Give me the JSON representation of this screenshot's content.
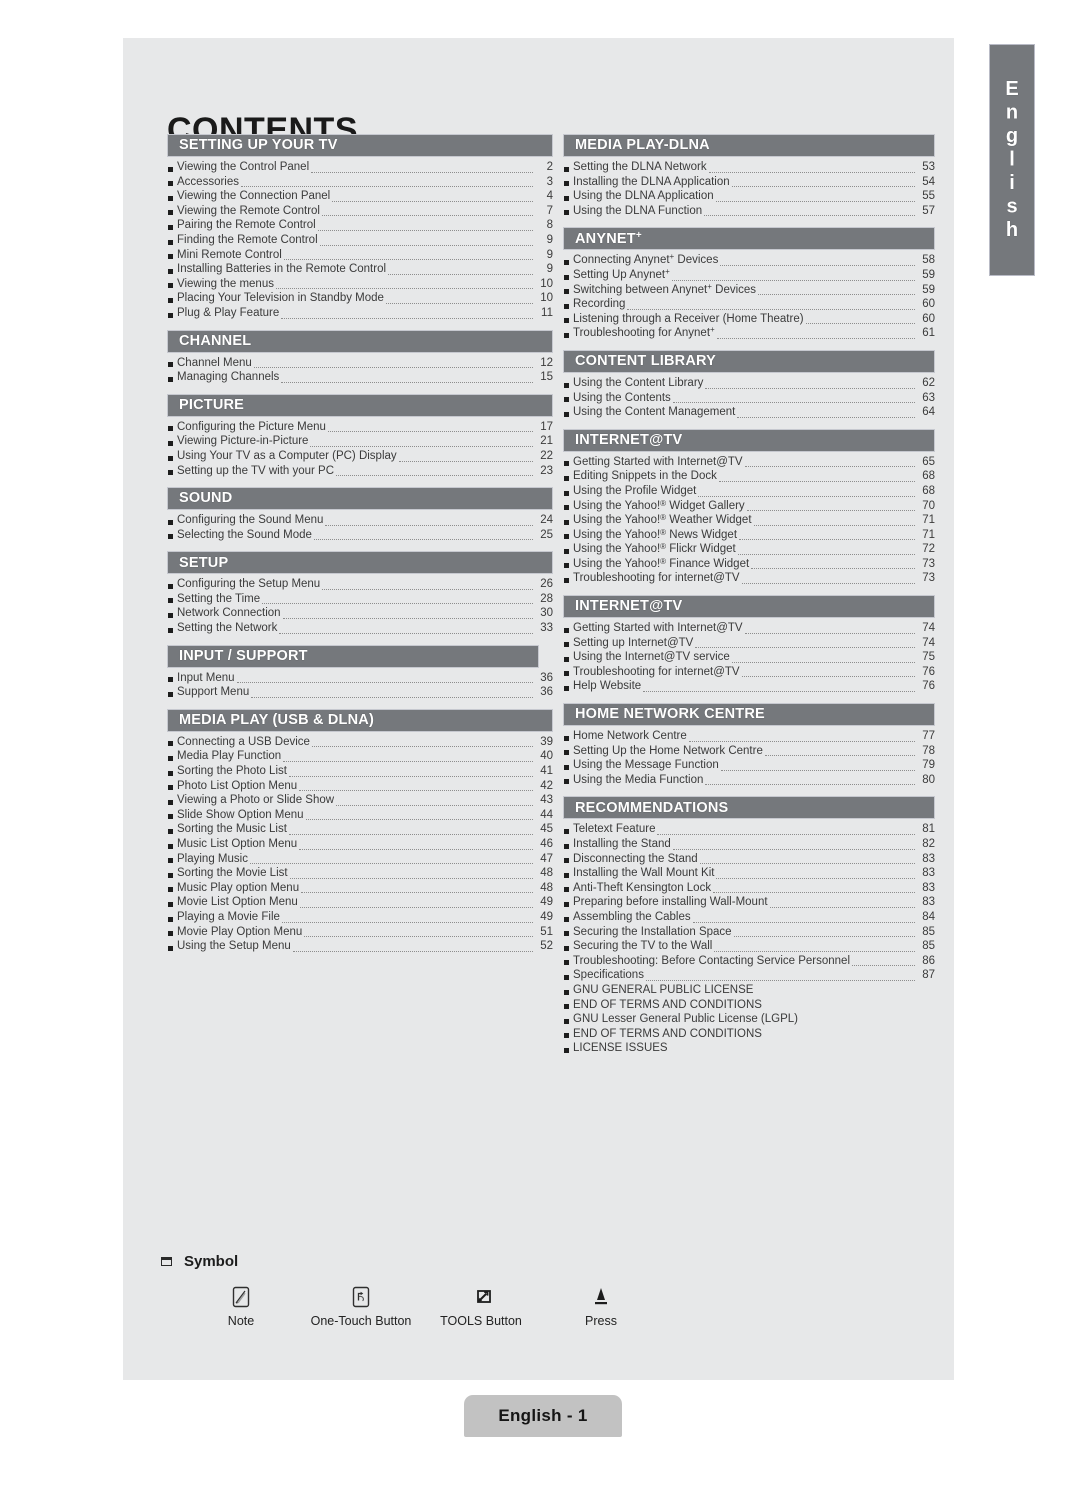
{
  "page_title": "CONTENTS",
  "language_tab": "English",
  "footer": {
    "page_label": "English - 1"
  },
  "colors": {
    "section_header_bg": "#75787c",
    "page_bg": "#e7e8e9",
    "badge_bg": "#c2c2c2",
    "text": "#3b3b3b"
  },
  "columns": {
    "left": [
      {
        "title": "SETTING UP YOUR TV",
        "items": [
          {
            "label": "Viewing the Control Panel",
            "page": "2"
          },
          {
            "label": "Accessories",
            "page": "3"
          },
          {
            "label": "Viewing the Connection Panel",
            "page": "4"
          },
          {
            "label": "Viewing the Remote Control",
            "page": "7"
          },
          {
            "label": "Pairing the Remote Control",
            "page": "8"
          },
          {
            "label": "Finding the Remote Control",
            "page": "9"
          },
          {
            "label": "Mini Remote Control",
            "page": "9"
          },
          {
            "label": "Installing Batteries in the Remote Control",
            "page": "9"
          },
          {
            "label": "Viewing the menus",
            "page": "10"
          },
          {
            "label": "Placing Your Television in Standby Mode",
            "page": "10"
          },
          {
            "label": "Plug & Play Feature",
            "page": "11"
          }
        ]
      },
      {
        "title": "CHANNEL",
        "items": [
          {
            "label": "Channel Menu",
            "page": "12"
          },
          {
            "label": "Managing Channels",
            "page": "15"
          }
        ]
      },
      {
        "title": "PICTURE",
        "items": [
          {
            "label": "Configuring the Picture Menu",
            "page": "17"
          },
          {
            "label": "Viewing Picture-in-Picture",
            "page": "21"
          },
          {
            "label": "Using Your TV as a Computer (PC) Display",
            "page": "22"
          },
          {
            "label": "Setting up the TV with your PC",
            "page": "23"
          }
        ]
      },
      {
        "title": "SOUND",
        "items": [
          {
            "label": "Configuring the Sound Menu",
            "page": "24"
          },
          {
            "label": "Selecting the Sound Mode",
            "page": "25"
          }
        ]
      },
      {
        "title": "SETUP",
        "items": [
          {
            "label": "Configuring the Setup Menu",
            "page": "26"
          },
          {
            "label": "Setting the Time",
            "page": "28"
          },
          {
            "label": "Network Connection",
            "page": "30"
          },
          {
            "label": "Setting the Network",
            "page": "33"
          }
        ]
      },
      {
        "title": "INPUT / SUPPORT",
        "narrow": true,
        "items": [
          {
            "label": "Input Menu",
            "page": "36"
          },
          {
            "label": "Support Menu",
            "page": "36"
          }
        ]
      },
      {
        "title": "MEDIA PLAY (USB & DLNA)",
        "items": [
          {
            "label": "Connecting a USB Device",
            "page": "39"
          },
          {
            "label": "Media Play Function",
            "page": "40"
          },
          {
            "label": "Sorting the Photo List",
            "page": "41"
          },
          {
            "label": "Photo List Option Menu",
            "page": "42"
          },
          {
            "label": "Viewing a Photo or Slide Show",
            "page": "43"
          },
          {
            "label": "Slide Show Option Menu",
            "page": "44"
          },
          {
            "label": "Sorting the Music List",
            "page": "45"
          },
          {
            "label": "Music List Option Menu",
            "page": "46"
          },
          {
            "label": "Playing Music",
            "page": "47"
          },
          {
            "label": "Sorting the Movie List",
            "page": "48"
          },
          {
            "label": "Music Play option Menu",
            "page": "48"
          },
          {
            "label": "Movie List Option Menu",
            "page": "49"
          },
          {
            "label": "Playing a Movie File",
            "page": "49"
          },
          {
            "label": "Movie Play Option Menu",
            "page": "51"
          },
          {
            "label": "Using the Setup Menu",
            "page": "52"
          }
        ]
      }
    ],
    "right": [
      {
        "title": "MEDIA PLAY-DLNA",
        "items": [
          {
            "label": "Setting the DLNA Network",
            "page": "53"
          },
          {
            "label": "Installing the DLNA Application",
            "page": "54"
          },
          {
            "label": "Using the DLNA Application",
            "page": "55"
          },
          {
            "label": "Using the DLNA Function",
            "page": "57"
          }
        ]
      },
      {
        "title": "ANYNET+",
        "title_sup": "+",
        "title_base": "ANYNET",
        "items": [
          {
            "label": "Connecting Anynet+ Devices",
            "page": "58",
            "sup_after": "Anynet"
          },
          {
            "label": "Setting Up Anynet+",
            "page": "59",
            "sup_after": "Anynet"
          },
          {
            "label": "Switching between Anynet+ Devices",
            "page": "59",
            "sup_after": "Anynet"
          },
          {
            "label": "Recording",
            "page": "60"
          },
          {
            "label": "Listening through a Receiver (Home Theatre)",
            "page": "60"
          },
          {
            "label": "Troubleshooting for Anynet+",
            "page": "61",
            "sup_after": "Anynet"
          }
        ]
      },
      {
        "title": "CONTENT LIBRARY",
        "items": [
          {
            "label": "Using the Content Library",
            "page": "62"
          },
          {
            "label": "Using the Contents",
            "page": "63"
          },
          {
            "label": "Using the Content Management",
            "page": "64"
          }
        ]
      },
      {
        "title": "INTERNET@TV",
        "items": [
          {
            "label": "Getting Started with Internet@TV",
            "page": "65"
          },
          {
            "label": "Editing Snippets in the Dock",
            "page": "68"
          },
          {
            "label": "Using the Profile Widget",
            "page": "68"
          },
          {
            "label": "Using the Yahoo!® Widget Gallery",
            "page": "70"
          },
          {
            "label": "Using the Yahoo!® Weather Widget",
            "page": "71"
          },
          {
            "label": "Using the Yahoo!® News Widget",
            "page": "71"
          },
          {
            "label": "Using the Yahoo!® Flickr Widget",
            "page": "72"
          },
          {
            "label": "Using the Yahoo!® Finance Widget",
            "page": "73"
          },
          {
            "label": "Troubleshooting for internet@TV",
            "page": "73"
          }
        ]
      },
      {
        "title": "INTERNET@TV",
        "items": [
          {
            "label": "Getting Started with Internet@TV",
            "page": "74"
          },
          {
            "label": "Setting up Internet@TV",
            "page": "74"
          },
          {
            "label": "Using the Internet@TV service",
            "page": "75"
          },
          {
            "label": "Troubleshooting for internet@TV",
            "page": "76"
          },
          {
            "label": "Help Website",
            "page": "76"
          }
        ]
      },
      {
        "title": "HOME NETWORK CENTRE",
        "items": [
          {
            "label": "Home Network Centre",
            "page": "77"
          },
          {
            "label": "Setting Up the Home Network Centre",
            "page": "78"
          },
          {
            "label": "Using the Message Function",
            "page": "79"
          },
          {
            "label": "Using the Media Function",
            "page": "80"
          }
        ]
      },
      {
        "title": "RECOMMENDATIONS",
        "items": [
          {
            "label": "Teletext Feature",
            "page": "81"
          },
          {
            "label": "Installing the Stand",
            "page": "82"
          },
          {
            "label": "Disconnecting the Stand",
            "page": "83"
          },
          {
            "label": "Installing the Wall Mount Kit",
            "page": "83"
          },
          {
            "label": "Anti-Theft Kensington Lock",
            "page": "83"
          },
          {
            "label": "Preparing before installing Wall-Mount",
            "page": "83"
          },
          {
            "label": "Assembling the Cables",
            "page": "84"
          },
          {
            "label": "Securing the Installation Space",
            "page": "85"
          },
          {
            "label": "Securing the TV to the Wall",
            "page": "85"
          },
          {
            "label": "Troubleshooting: Before Contacting Service Personnel",
            "page": "86"
          },
          {
            "label": "Specifications",
            "page": "87"
          },
          {
            "label": "GNU GENERAL PUBLIC LICENSE",
            "page": ""
          },
          {
            "label": "END OF TERMS AND CONDITIONS",
            "page": ""
          },
          {
            "label": "GNU Lesser General Public License (LGPL)",
            "page": ""
          },
          {
            "label": "END OF TERMS AND CONDITIONS",
            "page": ""
          },
          {
            "label": "LICENSE ISSUES",
            "page": ""
          }
        ]
      }
    ]
  },
  "symbol": {
    "heading": "Symbol",
    "entries": [
      {
        "icon": "note-icon",
        "caption": "Note"
      },
      {
        "icon": "one-touch-button-icon",
        "caption": "One-Touch Button"
      },
      {
        "icon": "tools-button-icon",
        "caption": "TOOLS Button"
      },
      {
        "icon": "press-icon",
        "caption": "Press"
      }
    ]
  }
}
